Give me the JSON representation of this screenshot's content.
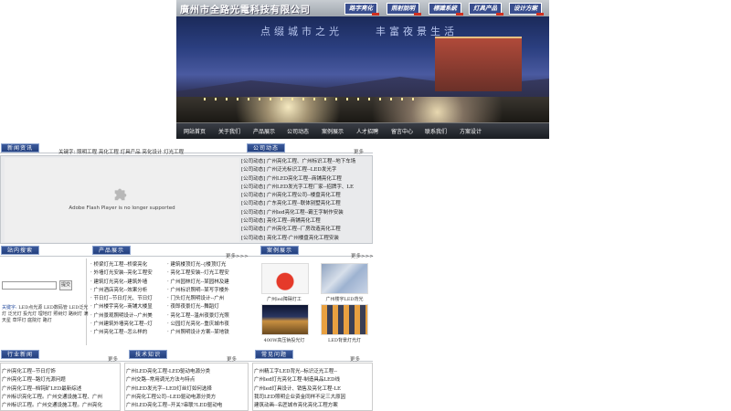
{
  "header": {
    "company": "廣州市全路光電科技有限公司",
    "top_links": [
      "路字亮化",
      "照射說明",
      "標識系統",
      "灯具产品",
      "设计方案"
    ],
    "slogan_left": "点缀城市之光",
    "slogan_right": "丰富夜景生活"
  },
  "nav": [
    "网站首页",
    "关于我们",
    "产品展示",
    "公司动态",
    "案例展示",
    "人才招聘",
    "留言中心",
    "联系我们",
    "方案设计"
  ],
  "section1": {
    "tab_left": "新闻资讯",
    "ticker": "关键字: 照明工程 亮化工程 灯具产品 亮化设计 灯光工程",
    "tab_right": "公司动态",
    "more": "更多",
    "flash_message": "Adobe Flash Player is no longer supported",
    "news": [
      "[公司动态] 广州亮化工程、广州标识工程--地下车场",
      "[公司动态] 广州泛光标识工程--LED发光字",
      "[公司动态] 广州LED亮化工程--商铺亮化工程",
      "[公司动态] 广州LED发光字工程厂家--招牌字、LE",
      "[公司动态] 广州亮化工程公司--楼盘亮化工程",
      "[公司动态] 广东亮化工程--联体别墅亮化工程",
      "[公司动态] 广州led亮化工程--霸王字制作安装",
      "[公司动态] 亮化工程--商铺亮化工程",
      "[公司动态] 广州亮化工程--厂房改造亮化工程",
      "[公司动态] 亮化工程-广州楼盘亮化工程安装"
    ]
  },
  "section2": {
    "tab_search": "站内搜索",
    "tab_products": "产品展示",
    "tab_cases": "案例展示",
    "more": "更多>>>",
    "search_button": "提交",
    "keywords_label": "关键字:",
    "keywords": "LED点光源 LED数码管 LED泛光灯 泛光灯 投光灯 埋地灯 照树灯 路树灯 满天星 草坪灯 庭院灯 路灯",
    "products_col1": [
      "桥梁灯光工程--桥梁亮化",
      "外墙灯光安装--亮化工程安",
      "建筑灯光亮化--建筑外墙",
      "广州酒店亮化--效果分析",
      "节日灯--节日灯光、节日灯",
      "广州楼宇亮化--商铺大楼显",
      "广州景观照明设计--广州美",
      "广州建筑外墙亮化工程--灯",
      "广州亮化工程--怎么样的"
    ],
    "products_col2": [
      "建筑楼顶灯光--[楼顶灯光",
      "亮化工程安装--灯光工程安",
      "广州园林灯光--某园林及建",
      "广州标识照明--某写字楼外",
      "门头灯光照明设计--广州",
      "夜郎夜景灯光--舞蹈灯",
      "亮化工程--温州夜景灯光照",
      "公园灯光亮化--重庆城市夜",
      "广州照明设计方案--某地铁"
    ],
    "cases": [
      "广州led障碍灯工",
      "广州楼宇LED背光",
      "400W高压钠投光灯",
      "LED背景灯光灯"
    ]
  },
  "section3": {
    "tab1": "行业新闻",
    "tab2": "技术知识",
    "tab3": "常见问题",
    "more": "更多",
    "col1": [
      "广州亮化工程--节日灯饰",
      "广州亮化工程--路灯光源问题",
      "广州亮化工程--档钝矿LED最新综述",
      "广州标识亮化工程。广州交通设施工程、广州",
      "广州标识工程。广州交通设施工程。广州亮化"
    ],
    "col2": [
      "广州LED亮化工程-LED驱动电源分类",
      "广州交路--常用调光方法与特点",
      "广州LED发光字--LED灯丝灯如何选择",
      "广州亮化工程公司--LED驱动电源分类方",
      "广州LED亮化工程--开关?串联?LED驱动电"
    ],
    "col3": [
      "广州精工字LED背光--标识泛光工程--",
      "广州led灯光亮化工程-制造具品LED线",
      "广州led灯具设计、销售及亮化工程-LE",
      "我司LED照明企业资金同样不足三大原因",
      "建筑动画--名匠城市亮化亮化工程方案"
    ]
  }
}
